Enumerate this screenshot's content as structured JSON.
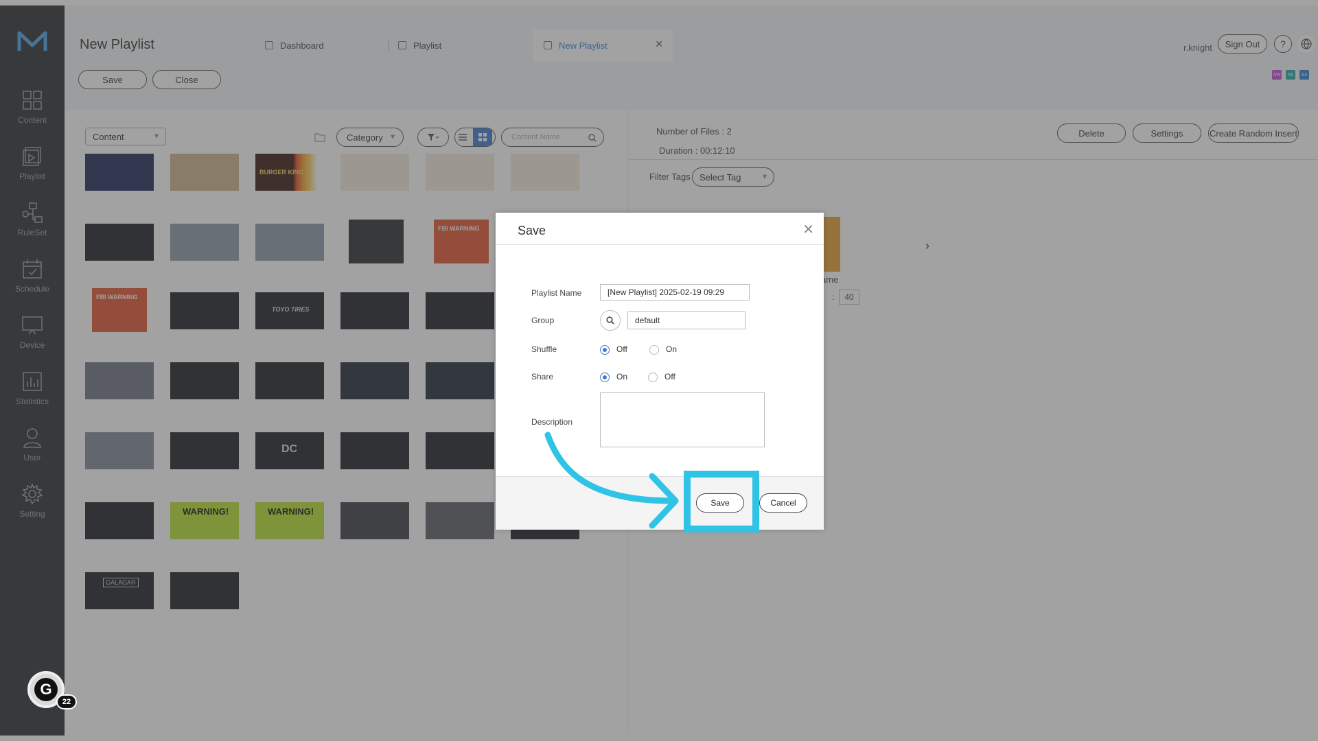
{
  "app": {
    "page_title": "New Playlist",
    "user": "r.knight",
    "sign_out": "Sign Out",
    "help": "?",
    "notification_count": "22"
  },
  "sidebar": {
    "items": [
      {
        "label": "Content",
        "icon": "grid-icon"
      },
      {
        "label": "Playlist",
        "icon": "playlist-icon"
      },
      {
        "label": "RuleSet",
        "icon": "ruleset-icon"
      },
      {
        "label": "Schedule",
        "icon": "calendar-icon"
      },
      {
        "label": "Device",
        "icon": "monitor-icon"
      },
      {
        "label": "Statistics",
        "icon": "chart-icon"
      },
      {
        "label": "User",
        "icon": "user-icon"
      },
      {
        "label": "Setting",
        "icon": "gear-icon"
      }
    ]
  },
  "tabs": [
    {
      "label": "Dashboard"
    },
    {
      "label": "Playlist"
    },
    {
      "label": "New Playlist",
      "active": true
    }
  ],
  "toolbar": {
    "save": "Save",
    "close": "Close"
  },
  "chips": [
    "SW",
    "S6",
    "S4"
  ],
  "content_panel": {
    "type_select": "Content",
    "category": "Category",
    "search_placeholder": "Content Name"
  },
  "playlist_panel": {
    "num_files": "Number of Files : 2",
    "duration": "Duration : 00:12:10",
    "delete": "Delete",
    "settings": "Settings",
    "random_insert": "Create Random Insert",
    "filter_tags_label": "Filter Tags",
    "select_tag": "Select Tag",
    "item_name_fragment": "ame",
    "time_value": "40"
  },
  "thumb_labels": {
    "bk": "BURGER KING",
    "fbi": "FBI WARNING",
    "toyo": "TOYO TIRES",
    "warning": "WARNING!",
    "dc": "DC",
    "galaxy": "GALAGAR"
  },
  "dialog": {
    "title": "Save",
    "playlist_name_label": "Playlist Name",
    "playlist_name_value": "[New Playlist] 2025-02-19 09:29",
    "group_label": "Group",
    "group_value": "default",
    "shuffle_label": "Shuffle",
    "shuffle_off": "Off",
    "shuffle_on": "On",
    "share_label": "Share",
    "share_on": "On",
    "share_off": "Off",
    "description_label": "Description",
    "save": "Save",
    "cancel": "Cancel"
  },
  "colors": {
    "accent": "#3d7ad6",
    "highlight": "#2fc3e6",
    "sidebar": "#2b2d30"
  }
}
